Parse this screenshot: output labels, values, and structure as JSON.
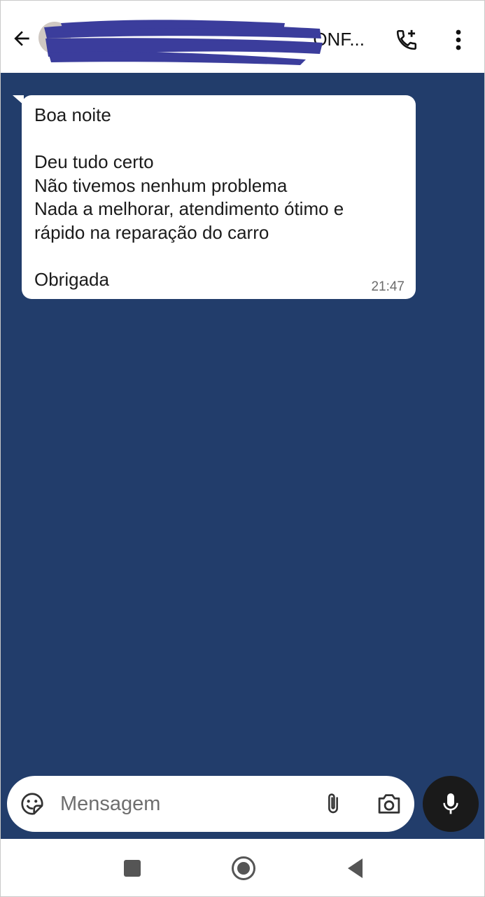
{
  "header": {
    "title": "ONF...",
    "icons": {
      "back": "arrow-left-icon",
      "call": "phone-add-icon",
      "more": "more-vertical-icon"
    },
    "redaction_color": "#3b3d9c"
  },
  "message": {
    "lines": [
      "Boa noite",
      "",
      "Deu tudo certo",
      "Não tivemos nenhum problema",
      "Nada a melhorar, atendimento ótimo e",
      "rápido na reparação do carro",
      "",
      "Obrigada"
    ],
    "time": "21:47"
  },
  "composer": {
    "placeholder": "Mensagem",
    "icons": {
      "emoji": "sticker-icon",
      "attach": "paperclip-icon",
      "camera": "camera-icon",
      "mic": "microphone-icon"
    }
  },
  "navbar": {
    "icons": [
      "square-recents-icon",
      "circle-home-icon",
      "triangle-back-icon"
    ]
  },
  "colors": {
    "chat_background": "#223d6b",
    "bubble": "#ffffff",
    "mic_button": "#1a1a1a"
  }
}
